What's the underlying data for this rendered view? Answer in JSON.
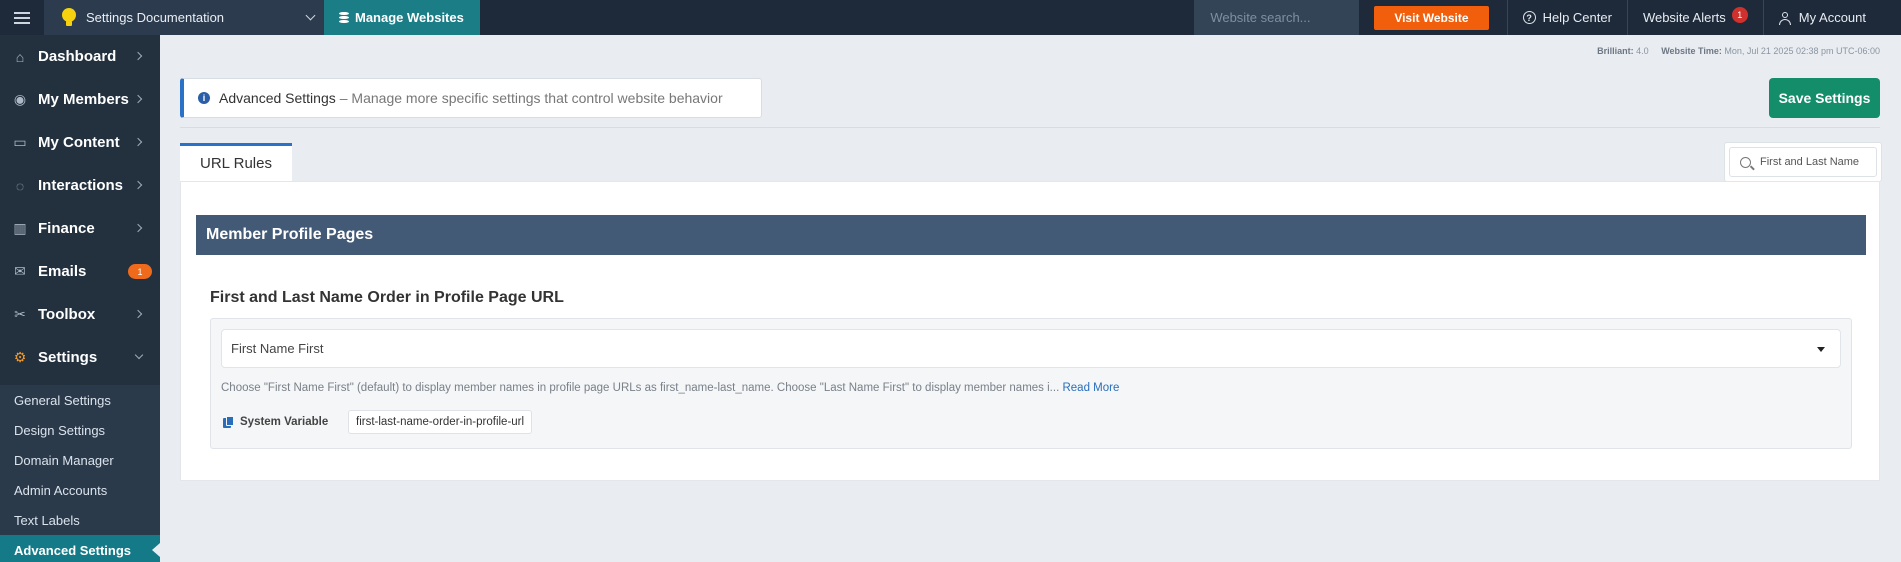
{
  "topbar": {
    "site_name": "Settings Documentation",
    "manage_label": "Manage Websites",
    "search_placeholder": "Website search...",
    "visit_label": "Visit Website",
    "help_label": "Help Center",
    "alerts_label": "Website Alerts",
    "alerts_count": "1",
    "account_label": "My Account"
  },
  "sidebar": {
    "items": [
      {
        "label": "Dashboard",
        "icon": "home-icon"
      },
      {
        "label": "My Members",
        "icon": "user-circle-icon"
      },
      {
        "label": "My Content",
        "icon": "folder-icon"
      },
      {
        "label": "Interactions",
        "icon": "chat-icon"
      },
      {
        "label": "Finance",
        "icon": "bar-chart-icon"
      },
      {
        "label": "Emails",
        "icon": "envelope-icon",
        "badge": "1"
      },
      {
        "label": "Toolbox",
        "icon": "tools-icon"
      },
      {
        "label": "Settings",
        "icon": "gear-icon"
      }
    ],
    "sub_items": [
      {
        "label": "General Settings"
      },
      {
        "label": "Design Settings"
      },
      {
        "label": "Domain Manager"
      },
      {
        "label": "Admin Accounts"
      },
      {
        "label": "Text Labels"
      },
      {
        "label": "Advanced Settings",
        "active": true
      }
    ]
  },
  "meta": {
    "brilliant_label": "Brilliant:",
    "brilliant_version": "4.0",
    "time_label": "Website Time:",
    "time_value": "Mon, Jul 21 2025 02:38 pm UTC-06:00"
  },
  "info": {
    "title": "Advanced Settings",
    "description": "– Manage more specific settings that control website behavior"
  },
  "save_label": "Save Settings",
  "tab_label": "URL Rules",
  "field_search_value": "First and Last Name",
  "section": {
    "title": "Member Profile Pages",
    "setting_title": "First and Last Name Order in Profile Page URL",
    "select_value": "First Name First",
    "help_text": "Choose \"First Name First\" (default) to display member names in profile page URLs as first_name-last_name. Choose \"Last Name First\" to display member names i...",
    "read_more": "Read More",
    "sysvar_label": "System Variable",
    "sysvar_value": "first-last-name-order-in-profile-url"
  },
  "colors": {
    "topbar": "#1e2a3a",
    "sidebar": "#23313f",
    "manage_button": "#1b7d86",
    "visit_button": "#f25f0c",
    "save_button": "#138d6a",
    "section_header": "#435a77",
    "accent_blue": "#2a72c8",
    "active_sub_item": "#157a87"
  }
}
